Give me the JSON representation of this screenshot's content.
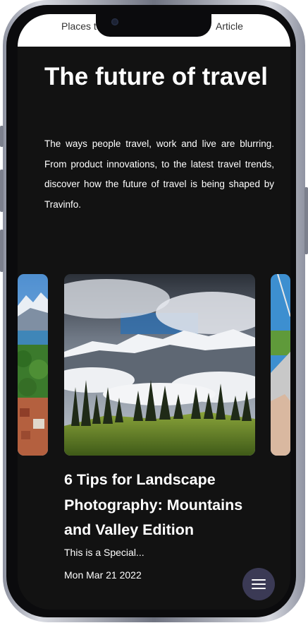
{
  "topbar": {
    "tab_left": "Places to",
    "tab_right": "Article"
  },
  "hero": {
    "title": "The future of travel",
    "description": "The ways people travel, work and live are blurring. From product innovations, to the latest travel trends, discover how the future of travel is being shaped by Travinfo."
  },
  "article": {
    "title": "6 Tips for Landscape Photography: Mountains and Valley Edition",
    "excerpt": "This is a Special...",
    "date": "Mon Mar 21 2022"
  },
  "icons": {
    "menu": "hamburger-menu-icon",
    "camera": "front-camera-icon"
  },
  "colors": {
    "background": "#121212",
    "fab": "#3b3a55",
    "text": "#ffffff"
  }
}
